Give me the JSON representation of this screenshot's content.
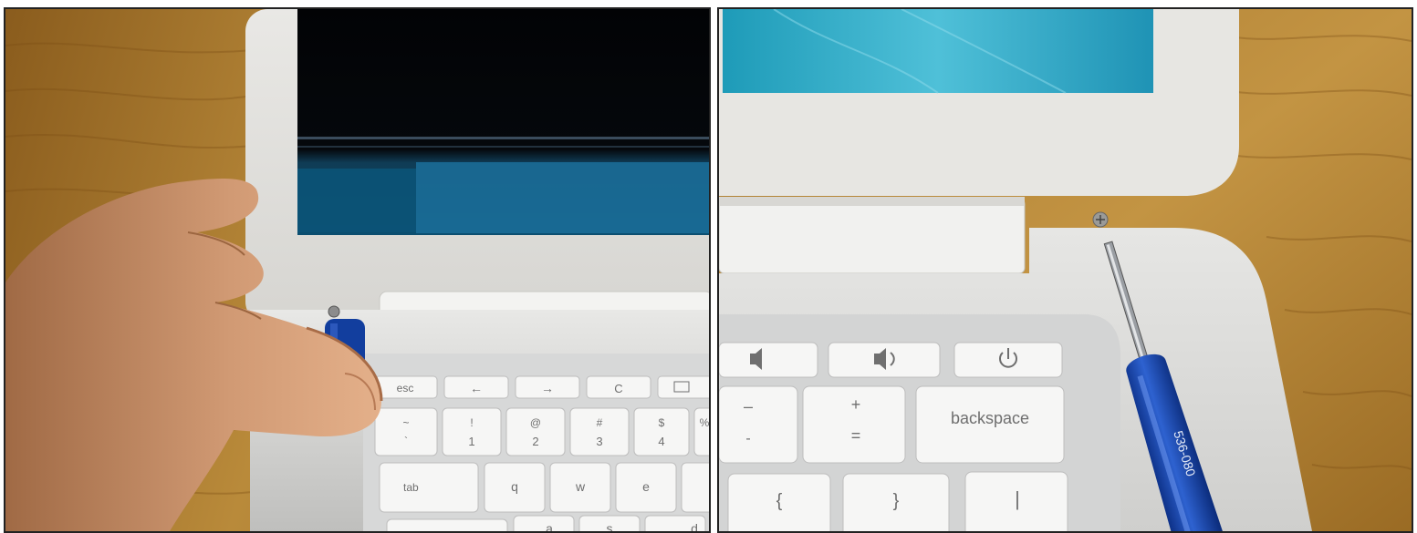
{
  "photos": [
    {
      "keys": {
        "esc": "esc",
        "back": "←",
        "forward": "→",
        "refresh": "C",
        "excl": "!",
        "one": "1",
        "at": "@",
        "two": "2",
        "hash": "#",
        "three": "3",
        "dollar": "$",
        "four": "4",
        "pct": "%",
        "tilde": "~",
        "backtick": "`",
        "tab": "tab",
        "q": "q",
        "w": "w",
        "e": "e",
        "a": "a",
        "s": "s",
        "d": "d"
      }
    },
    {
      "keys": {
        "minus": "–",
        "underscore": "-",
        "plus": "+",
        "equals": "=",
        "backspace": "backspace",
        "lbrace": "{",
        "rbrace": "}",
        "pipe": "|"
      },
      "screwdriver_text": "536-080"
    }
  ],
  "colors": {
    "wood": "#b98a3a",
    "laptop_white": "#e7e6e2",
    "screen_black": "#05080c",
    "screen_teal": "#2aa7c6",
    "screwdriver_blue": "#123e9e"
  }
}
